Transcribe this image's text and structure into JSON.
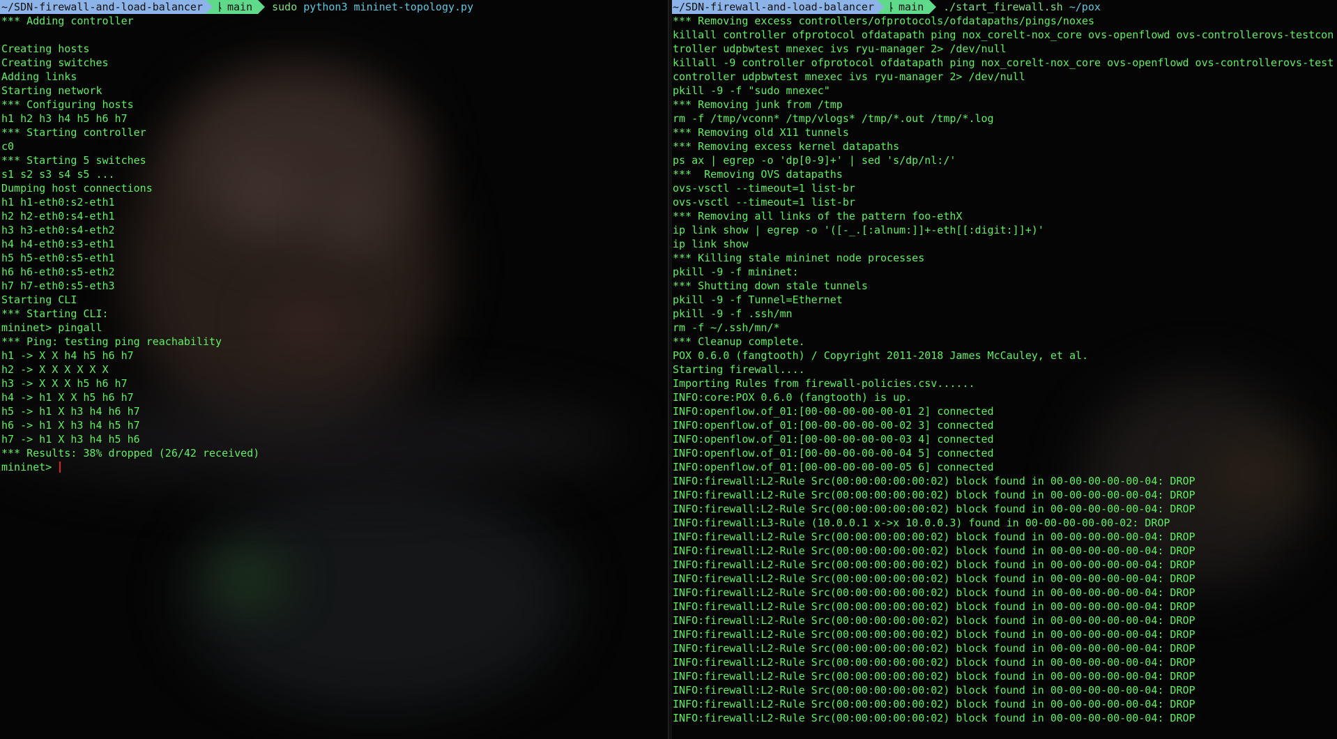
{
  "left_terminal": {
    "prompt": {
      "dir": "~/SDN-firewall-and-load-balancer",
      "branch": "main",
      "command_keyword": "sudo",
      "command_args": "python3 mininet-topology.py"
    },
    "output": [
      "*** Adding controller",
      "",
      "Creating hosts",
      "Creating switches",
      "Adding links",
      "Starting network",
      "*** Configuring hosts",
      "h1 h2 h3 h4 h5 h6 h7",
      "*** Starting controller",
      "c0",
      "*** Starting 5 switches",
      "s1 s2 s3 s4 s5 ...",
      "Dumping host connections",
      "h1 h1-eth0:s2-eth1",
      "h2 h2-eth0:s4-eth1",
      "h3 h3-eth0:s4-eth2",
      "h4 h4-eth0:s3-eth1",
      "h5 h5-eth0:s5-eth1",
      "h6 h6-eth0:s5-eth2",
      "h7 h7-eth0:s5-eth3",
      "Starting CLI",
      "*** Starting CLI:",
      "mininet> pingall",
      "*** Ping: testing ping reachability",
      "h1 -> X X h4 h5 h6 h7",
      "h2 -> X X X X X X",
      "h3 -> X X X h5 h6 h7",
      "h4 -> h1 X X h5 h6 h7",
      "h5 -> h1 X h3 h4 h6 h7",
      "h6 -> h1 X h3 h4 h5 h7",
      "h7 -> h1 X h3 h4 h5 h6",
      "*** Results: 38% dropped (26/42 received)"
    ],
    "input_prompt": "mininet> "
  },
  "right_terminal": {
    "prompt": {
      "dir": "~/SDN-firewall-and-load-balancer",
      "branch": "main",
      "command_keyword": "./start_firewall.sh",
      "command_args": "~/pox"
    },
    "output": [
      "*** Removing excess controllers/ofprotocols/ofdatapaths/pings/noxes",
      "killall controller ofprotocol ofdatapath ping nox_corelt-nox_core ovs-openflowd ovs-controllerovs-testcon",
      "troller udpbwtest mnexec ivs ryu-manager 2> /dev/null",
      "killall -9 controller ofprotocol ofdatapath ping nox_corelt-nox_core ovs-openflowd ovs-controllerovs-test",
      "controller udpbwtest mnexec ivs ryu-manager 2> /dev/null",
      "pkill -9 -f \"sudo mnexec\"",
      "*** Removing junk from /tmp",
      "rm -f /tmp/vconn* /tmp/vlogs* /tmp/*.out /tmp/*.log",
      "*** Removing old X11 tunnels",
      "*** Removing excess kernel datapaths",
      "ps ax | egrep -o 'dp[0-9]+' | sed 's/dp/nl:/'",
      "***  Removing OVS datapaths",
      "ovs-vsctl --timeout=1 list-br",
      "ovs-vsctl --timeout=1 list-br",
      "*** Removing all links of the pattern foo-ethX",
      "ip link show | egrep -o '([-_.[:alnum:]]+-eth[[:digit:]]+)'",
      "ip link show",
      "*** Killing stale mininet node processes",
      "pkill -9 -f mininet:",
      "*** Shutting down stale tunnels",
      "pkill -9 -f Tunnel=Ethernet",
      "pkill -9 -f .ssh/mn",
      "rm -f ~/.ssh/mn/*",
      "*** Cleanup complete.",
      "POX 0.6.0 (fangtooth) / Copyright 2011-2018 James McCauley, et al.",
      "Starting firewall....",
      "Importing Rules from firewall-policies.csv......",
      "INFO:core:POX 0.6.0 (fangtooth) is up.",
      "INFO:openflow.of_01:[00-00-00-00-00-01 2] connected",
      "INFO:openflow.of_01:[00-00-00-00-00-02 3] connected",
      "INFO:openflow.of_01:[00-00-00-00-00-03 4] connected",
      "INFO:openflow.of_01:[00-00-00-00-00-04 5] connected",
      "INFO:openflow.of_01:[00-00-00-00-00-05 6] connected",
      "INFO:firewall:L2-Rule Src(00:00:00:00:00:02) block found in 00-00-00-00-00-04: DROP",
      "INFO:firewall:L2-Rule Src(00:00:00:00:00:02) block found in 00-00-00-00-00-04: DROP",
      "INFO:firewall:L2-Rule Src(00:00:00:00:00:02) block found in 00-00-00-00-00-04: DROP",
      "INFO:firewall:L3-Rule (10.0.0.1 x->x 10.0.0.3) found in 00-00-00-00-00-02: DROP",
      "INFO:firewall:L2-Rule Src(00:00:00:00:00:02) block found in 00-00-00-00-00-04: DROP",
      "INFO:firewall:L2-Rule Src(00:00:00:00:00:02) block found in 00-00-00-00-00-04: DROP",
      "INFO:firewall:L2-Rule Src(00:00:00:00:00:02) block found in 00-00-00-00-00-04: DROP",
      "INFO:firewall:L2-Rule Src(00:00:00:00:00:02) block found in 00-00-00-00-00-04: DROP",
      "INFO:firewall:L2-Rule Src(00:00:00:00:00:02) block found in 00-00-00-00-00-04: DROP",
      "INFO:firewall:L2-Rule Src(00:00:00:00:00:02) block found in 00-00-00-00-00-04: DROP",
      "INFO:firewall:L2-Rule Src(00:00:00:00:00:02) block found in 00-00-00-00-00-04: DROP",
      "INFO:firewall:L2-Rule Src(00:00:00:00:00:02) block found in 00-00-00-00-00-04: DROP",
      "INFO:firewall:L2-Rule Src(00:00:00:00:00:02) block found in 00-00-00-00-00-04: DROP",
      "INFO:firewall:L2-Rule Src(00:00:00:00:00:02) block found in 00-00-00-00-00-04: DROP",
      "INFO:firewall:L2-Rule Src(00:00:00:00:00:02) block found in 00-00-00-00-00-04: DROP",
      "INFO:firewall:L2-Rule Src(00:00:00:00:00:02) block found in 00-00-00-00-00-04: DROP",
      "INFO:firewall:L2-Rule Src(00:00:00:00:00:02) block found in 00-00-00-00-00-04: DROP",
      "INFO:firewall:L2-Rule Src(00:00:00:00:00:02) block found in 00-00-00-00-00-04: DROP"
    ]
  },
  "colors": {
    "terminal_text": "#5ef05e",
    "prompt_dir_bg": "#8db4e8",
    "prompt_branch_bg": "#5fd98a",
    "command_args": "#5dc9e0",
    "cursor": "#e02020"
  },
  "icons": {
    "branch": "git-branch-icon"
  }
}
